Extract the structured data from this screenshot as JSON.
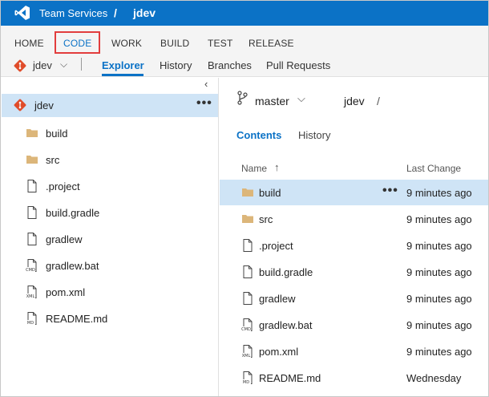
{
  "topbar": {
    "brand": "Team Services",
    "separator": "/",
    "project": "jdev",
    "bg_color": "#0b72c6"
  },
  "hubs": [
    {
      "label": "HOME",
      "icon": ""
    },
    {
      "label": "CODE",
      "active": true
    },
    {
      "label": "WORK"
    },
    {
      "label": "BUILD"
    },
    {
      "label": "TEST"
    },
    {
      "label": "RELEASE"
    }
  ],
  "subnav": {
    "repo_icon": "git-repo-icon",
    "repo": "jdev",
    "chevron": "⌵",
    "separator": "|",
    "tabs": [
      "Explorer",
      "History",
      "Branches",
      "Pull Requests"
    ],
    "active_tab": "Explorer"
  },
  "tree": {
    "collapse_glyph": "‹",
    "root": {
      "label": "jdev",
      "more": "•••"
    },
    "items": [
      {
        "label": "build",
        "icon": "folder-icon"
      },
      {
        "label": "src",
        "icon": "folder-icon"
      },
      {
        "label": ".project",
        "icon": "file-icon"
      },
      {
        "label": "build.gradle",
        "icon": "file-icon"
      },
      {
        "label": "gradlew",
        "icon": "file-icon"
      },
      {
        "label": "gradlew.bat",
        "icon": "cmd-file-icon",
        "tag": "CMD"
      },
      {
        "label": "pom.xml",
        "icon": "xml-file-icon",
        "tag": "XML"
      },
      {
        "label": "README.md",
        "icon": "md-file-icon",
        "tag": "MD"
      }
    ]
  },
  "content": {
    "branch": "master",
    "branch_chevron": "⌵",
    "path": "jdev",
    "path_sep": "/",
    "tabs": [
      "Contents",
      "History"
    ],
    "active_tab": "Contents",
    "columns": {
      "name": "Name",
      "sort_arrow": "↑",
      "last_change": "Last Change"
    },
    "rows": [
      {
        "name": "build",
        "icon": "folder-icon",
        "change": "9 minutes ago",
        "selected": true,
        "more": "•••"
      },
      {
        "name": "src",
        "icon": "folder-icon",
        "change": "9 minutes ago"
      },
      {
        "name": ".project",
        "icon": "file-icon",
        "change": "9 minutes ago"
      },
      {
        "name": "build.gradle",
        "icon": "file-icon",
        "change": "9 minutes ago"
      },
      {
        "name": "gradlew",
        "icon": "file-icon",
        "change": "9 minutes ago"
      },
      {
        "name": "gradlew.bat",
        "icon": "cmd-file-icon",
        "tag": "CMD",
        "change": "9 minutes ago"
      },
      {
        "name": "pom.xml",
        "icon": "xml-file-icon",
        "tag": "XML",
        "change": "9 minutes ago"
      },
      {
        "name": "README.md",
        "icon": "md-file-icon",
        "tag": "MD",
        "change": "Wednesday"
      }
    ]
  },
  "colors": {
    "accent": "#0b72c6",
    "selection": "#cfe4f6",
    "highlight_box": "#e23d3d",
    "folder": "#dcb67a",
    "git": "#e04c2a"
  }
}
